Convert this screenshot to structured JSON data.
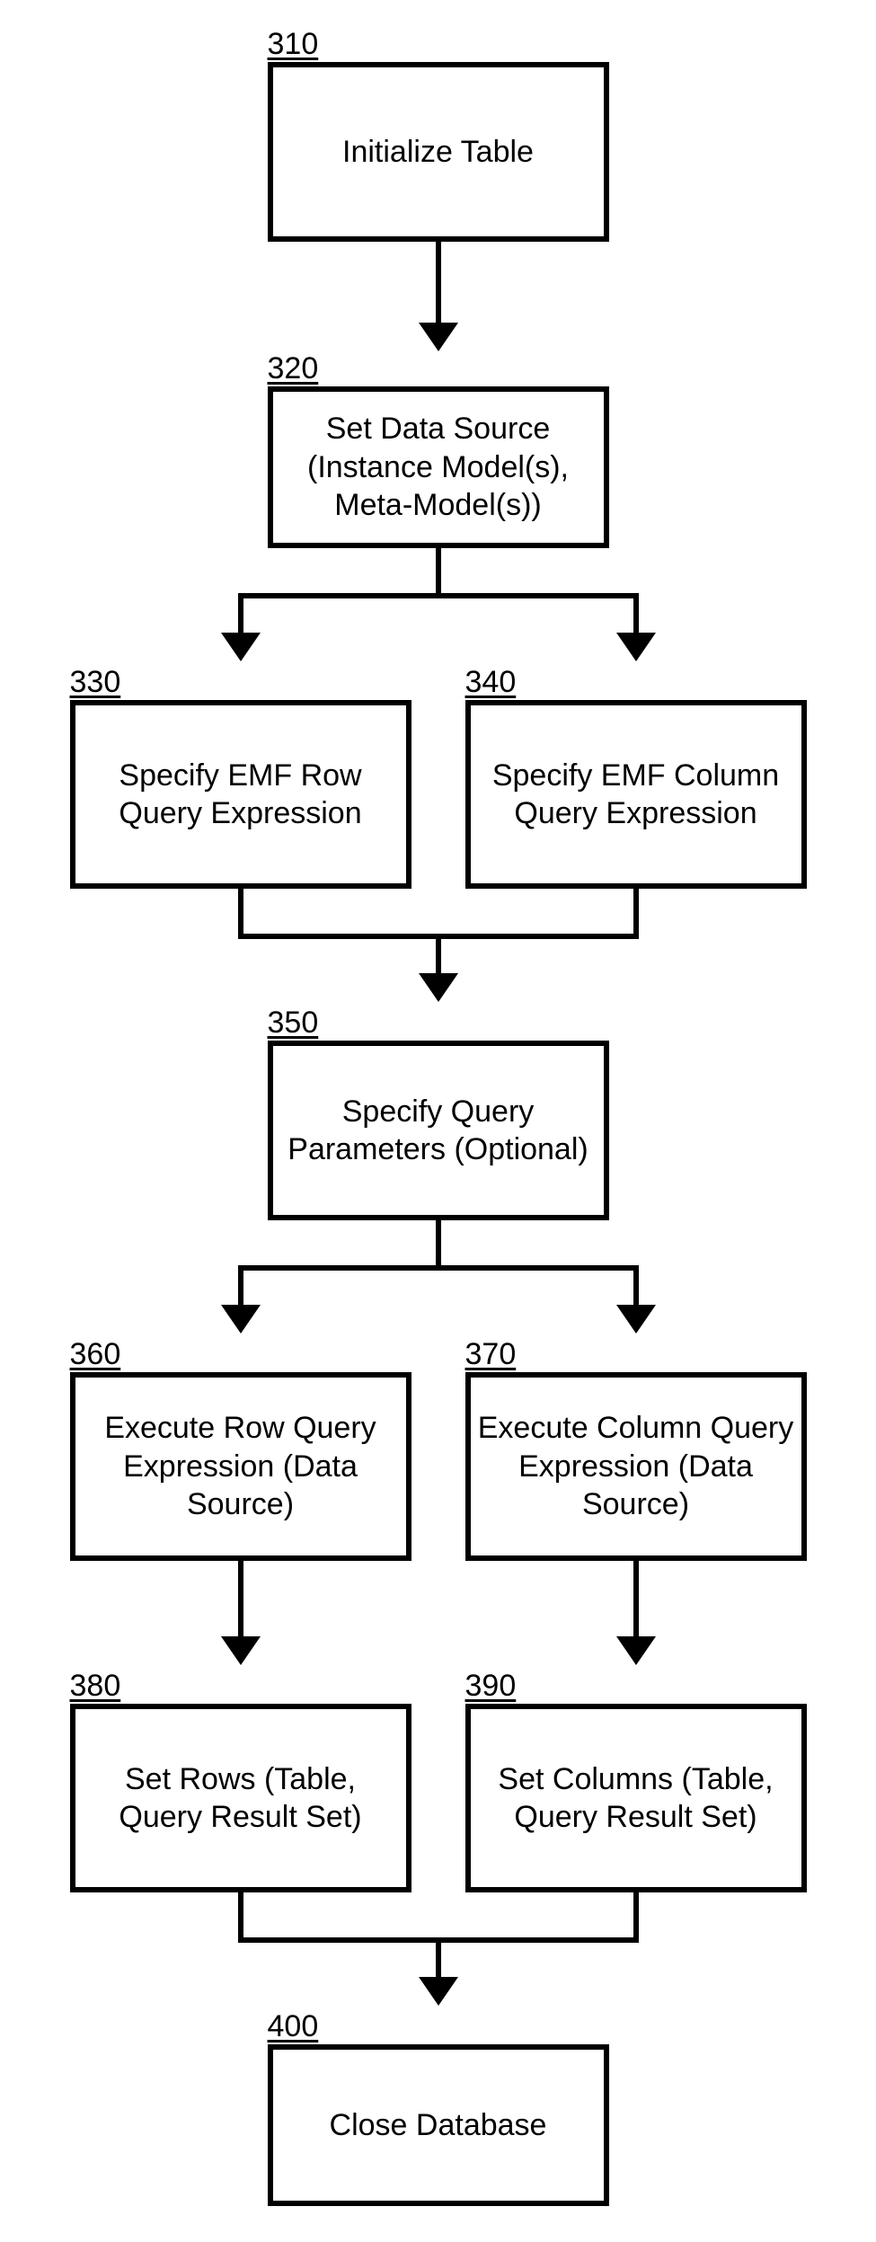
{
  "nodes": {
    "n310": {
      "label": "310",
      "text": "Initialize Table"
    },
    "n320": {
      "label": "320",
      "text": "Set Data Source (Instance Model(s), Meta-Model(s))"
    },
    "n330": {
      "label": "330",
      "text": "Specify EMF Row Query Expression"
    },
    "n340": {
      "label": "340",
      "text": "Specify EMF Column Query Expression"
    },
    "n350": {
      "label": "350",
      "text": "Specify Query Parameters (Optional)"
    },
    "n360": {
      "label": "360",
      "text": "Execute Row Query Expression (Data Source)"
    },
    "n370": {
      "label": "370",
      "text": "Execute Column Query Expression (Data Source)"
    },
    "n380": {
      "label": "380",
      "text": "Set Rows (Table, Query Result Set)"
    },
    "n390": {
      "label": "390",
      "text": "Set Columns (Table, Query Result Set)"
    },
    "n400": {
      "label": "400",
      "text": "Close Database"
    }
  },
  "flow": {
    "edges": [
      {
        "from": "n310",
        "to": "n320"
      },
      {
        "from": "n320",
        "to": "n330"
      },
      {
        "from": "n320",
        "to": "n340"
      },
      {
        "from": "n330",
        "to": "n350"
      },
      {
        "from": "n340",
        "to": "n350"
      },
      {
        "from": "n350",
        "to": "n360"
      },
      {
        "from": "n350",
        "to": "n370"
      },
      {
        "from": "n360",
        "to": "n380"
      },
      {
        "from": "n370",
        "to": "n390"
      },
      {
        "from": "n380",
        "to": "n400"
      },
      {
        "from": "n390",
        "to": "n400"
      }
    ]
  }
}
